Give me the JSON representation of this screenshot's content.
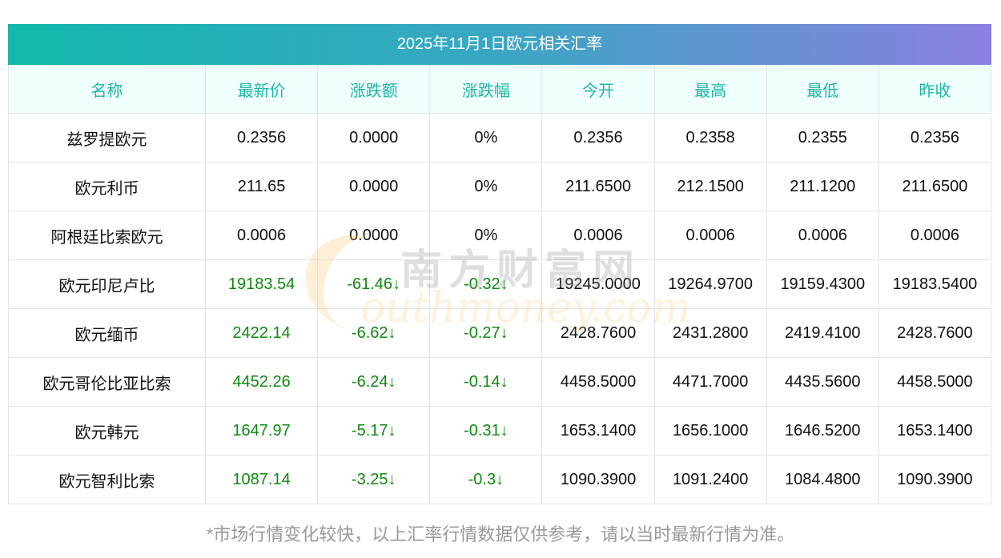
{
  "title": "2025年11月1日欧元相关汇率",
  "headers": [
    "名称",
    "最新价",
    "涨跌额",
    "涨跌幅",
    "今开",
    "最高",
    "最低",
    "昨收"
  ],
  "rows": [
    [
      "兹罗提欧元",
      "0.2356",
      "0.0000",
      "0%",
      "0.2356",
      "0.2358",
      "0.2355",
      "0.2356"
    ],
    [
      "欧元利币",
      "211.65",
      "0.0000",
      "0%",
      "211.6500",
      "212.1500",
      "211.1200",
      "211.6500"
    ],
    [
      "阿根廷比索欧元",
      "0.0006",
      "0.0000",
      "0%",
      "0.0006",
      "0.0006",
      "0.0006",
      "0.0006"
    ],
    [
      "欧元印尼卢比",
      "19183.54",
      "-61.46↓",
      "-0.32↓",
      "19245.0000",
      "19264.9700",
      "19159.4300",
      "19183.5400"
    ],
    [
      "欧元缅币",
      "2422.14",
      "-6.62↓",
      "-0.27↓",
      "2428.7600",
      "2431.2800",
      "2419.4100",
      "2428.7600"
    ],
    [
      "欧元哥伦比亚比索",
      "4452.26",
      "-6.24↓",
      "-0.14↓",
      "4458.5000",
      "4471.7000",
      "4435.5600",
      "4458.5000"
    ],
    [
      "欧元韩元",
      "1647.97",
      "-5.17↓",
      "-0.31↓",
      "1653.1400",
      "1656.1000",
      "1646.5200",
      "1653.1400"
    ],
    [
      "欧元智利比索",
      "1087.14",
      "-3.25↓",
      "-0.3↓",
      "1090.3900",
      "1091.2400",
      "1084.4800",
      "1090.3900"
    ]
  ],
  "green_rows": [
    3,
    4,
    5,
    6,
    7
  ],
  "footer": "*市场行情变化较快，以上汇率行情数据仅供参考，请以当时最新行情为准。",
  "watermark": {
    "cn": "南方财富网",
    "en": "outhmoney.com"
  }
}
